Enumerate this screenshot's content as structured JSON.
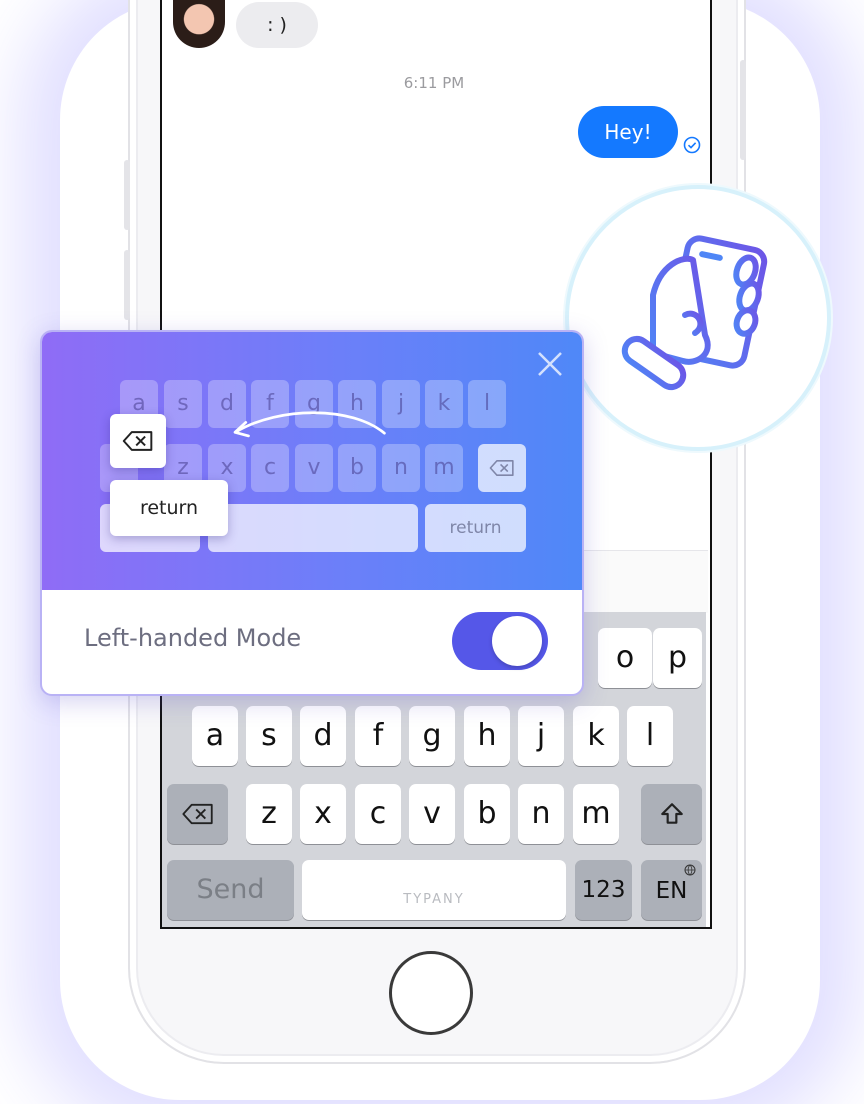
{
  "chat": {
    "incoming_text": ": )",
    "timestamp": "6:11 PM",
    "outgoing_text": "Hey!"
  },
  "keyboard": {
    "row2": [
      "o",
      "p"
    ],
    "row3": [
      "a",
      "s",
      "d",
      "f",
      "g",
      "h",
      "j",
      "k",
      "l"
    ],
    "row4": [
      "z",
      "x",
      "c",
      "v",
      "b",
      "n",
      "m"
    ],
    "send_label": "Send",
    "space_label": "TYPANY",
    "num_label": "123",
    "lang_label": "EN"
  },
  "card": {
    "mini_row1": [
      "a",
      "s",
      "d",
      "f",
      "g",
      "h",
      "j",
      "k",
      "l"
    ],
    "mini_row2": [
      "z",
      "x",
      "c",
      "v",
      "b",
      "n",
      "m"
    ],
    "mini_return_label": "return",
    "popup_return_label": "return",
    "mode_label": "Left-handed Mode",
    "toggle_on": true
  },
  "colors": {
    "accent": "#1479ff",
    "toggle": "#5557e8",
    "gradient_start": "#8f6cf6",
    "gradient_end": "#4f88f8"
  },
  "icons": {
    "circle_icon": "hand-holding-phone-icon"
  }
}
